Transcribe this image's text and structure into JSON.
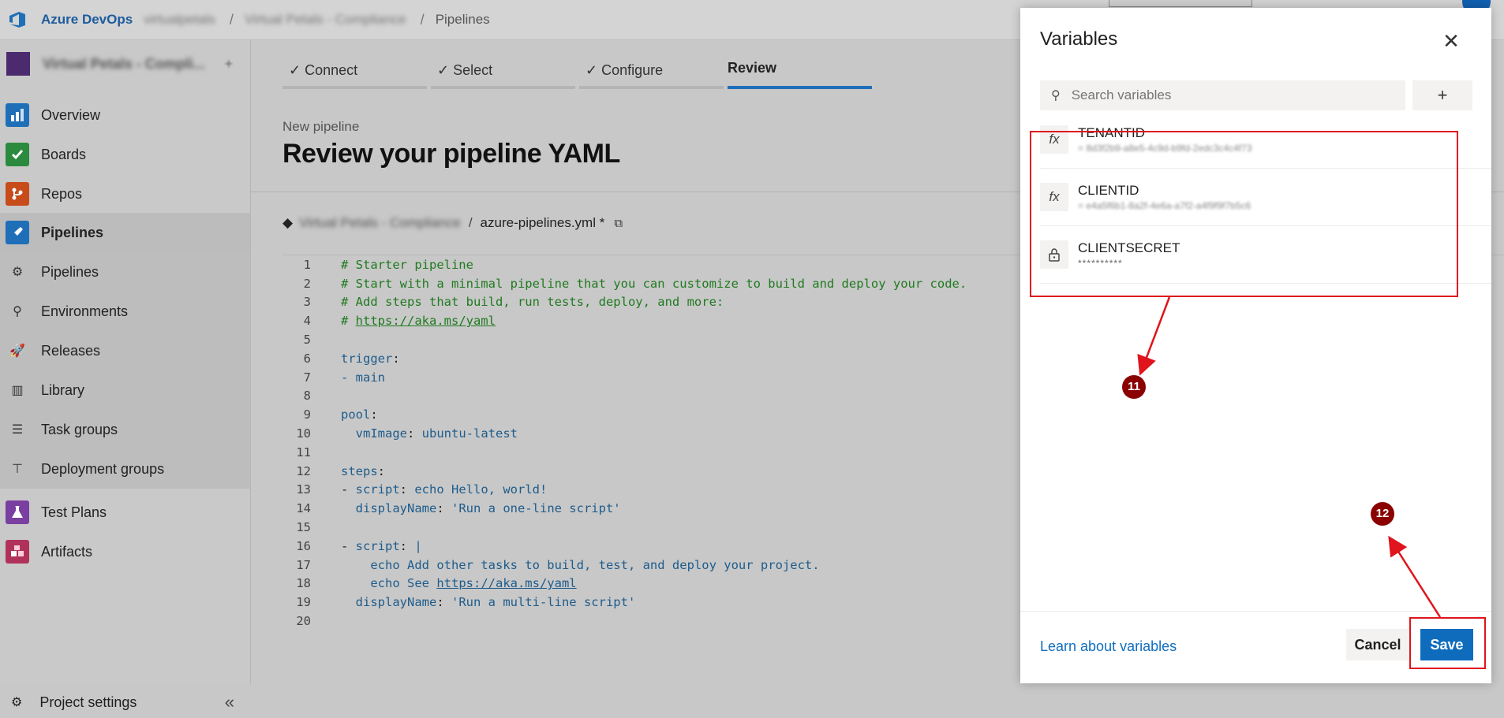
{
  "topbar": {
    "brand": "Azure DevOps",
    "org": "virtualpetals",
    "project": "Virtual Petals - Compliance",
    "page": "Pipelines"
  },
  "sidebar": {
    "project_name": "Virtual Petals - Compli...",
    "items": [
      {
        "label": "Overview",
        "icon": "overview-icon",
        "color": "#1f6fb8"
      },
      {
        "label": "Boards",
        "icon": "boards-icon",
        "color": "#2b8a3e"
      },
      {
        "label": "Repos",
        "icon": "repos-icon",
        "color": "#c84b1a"
      },
      {
        "label": "Pipelines",
        "icon": "pipelines-icon",
        "color": "#1f6fb8"
      }
    ],
    "sub_items": [
      {
        "label": "Pipelines",
        "icon": "pipelines-sub-icon"
      },
      {
        "label": "Environments",
        "icon": "environments-icon"
      },
      {
        "label": "Releases",
        "icon": "releases-icon"
      },
      {
        "label": "Library",
        "icon": "library-icon"
      },
      {
        "label": "Task groups",
        "icon": "task-groups-icon"
      },
      {
        "label": "Deployment groups",
        "icon": "deployment-groups-icon"
      }
    ],
    "bottom_items": [
      {
        "label": "Test Plans",
        "icon": "test-plans-icon",
        "color": "#7a3fa0"
      },
      {
        "label": "Artifacts",
        "icon": "artifacts-icon",
        "color": "#b0325a"
      }
    ],
    "settings_label": "Project settings",
    "collapse_glyph": "«"
  },
  "wizard": {
    "steps": [
      {
        "label": "✓ Connect",
        "state": "done"
      },
      {
        "label": "✓ Select",
        "state": "done"
      },
      {
        "label": "✓ Configure",
        "state": "done"
      },
      {
        "label": "Review",
        "state": "active"
      }
    ]
  },
  "page": {
    "subtitle": "New pipeline",
    "title": "Review your pipeline YAML",
    "repo": "Virtual Petals - Compliance",
    "file": "azure-pipelines.yml *"
  },
  "code_lines": [
    "# Starter pipeline",
    "# Start with a minimal pipeline that you can customize to build and deploy your code.",
    "# Add steps that build, run tests, deploy, and more:",
    "# https://aka.ms/yaml",
    "",
    "trigger:",
    "- main",
    "",
    "pool:",
    "  vmImage: ubuntu-latest",
    "",
    "steps:",
    "- script: echo Hello, world!",
    "  displayName: 'Run a one-line script'",
    "",
    "- script: |",
    "    echo Add other tasks to build, test, and deploy your project.",
    "    echo See https://aka.ms/yaml",
    "  displayName: 'Run a multi-line script'",
    ""
  ],
  "variables_panel": {
    "title": "Variables",
    "search_placeholder": "Search variables",
    "add_glyph": "+",
    "close_glyph": "✕",
    "variables": [
      {
        "name": "TENANTID",
        "value": "= 8d3f2b9-a8e5-4c9d-b9fd-2edc3c4c4f73",
        "icon": "fx-icon",
        "glyph": "fx"
      },
      {
        "name": "CLIENTID",
        "value": "= e4a5f6b1-8a2f-4e6a-a7f2-a4f9f9f7b5c6",
        "icon": "fx-icon",
        "glyph": "fx"
      },
      {
        "name": "CLIENTSECRET",
        "value": "**********",
        "icon": "lock-icon",
        "glyph": "🔒"
      }
    ],
    "learn_link": "Learn about variables",
    "cancel_label": "Cancel",
    "save_label": "Save"
  },
  "annotations": {
    "callout_1": "11",
    "callout_2": "12",
    "highlight_color": "#e0141c"
  }
}
